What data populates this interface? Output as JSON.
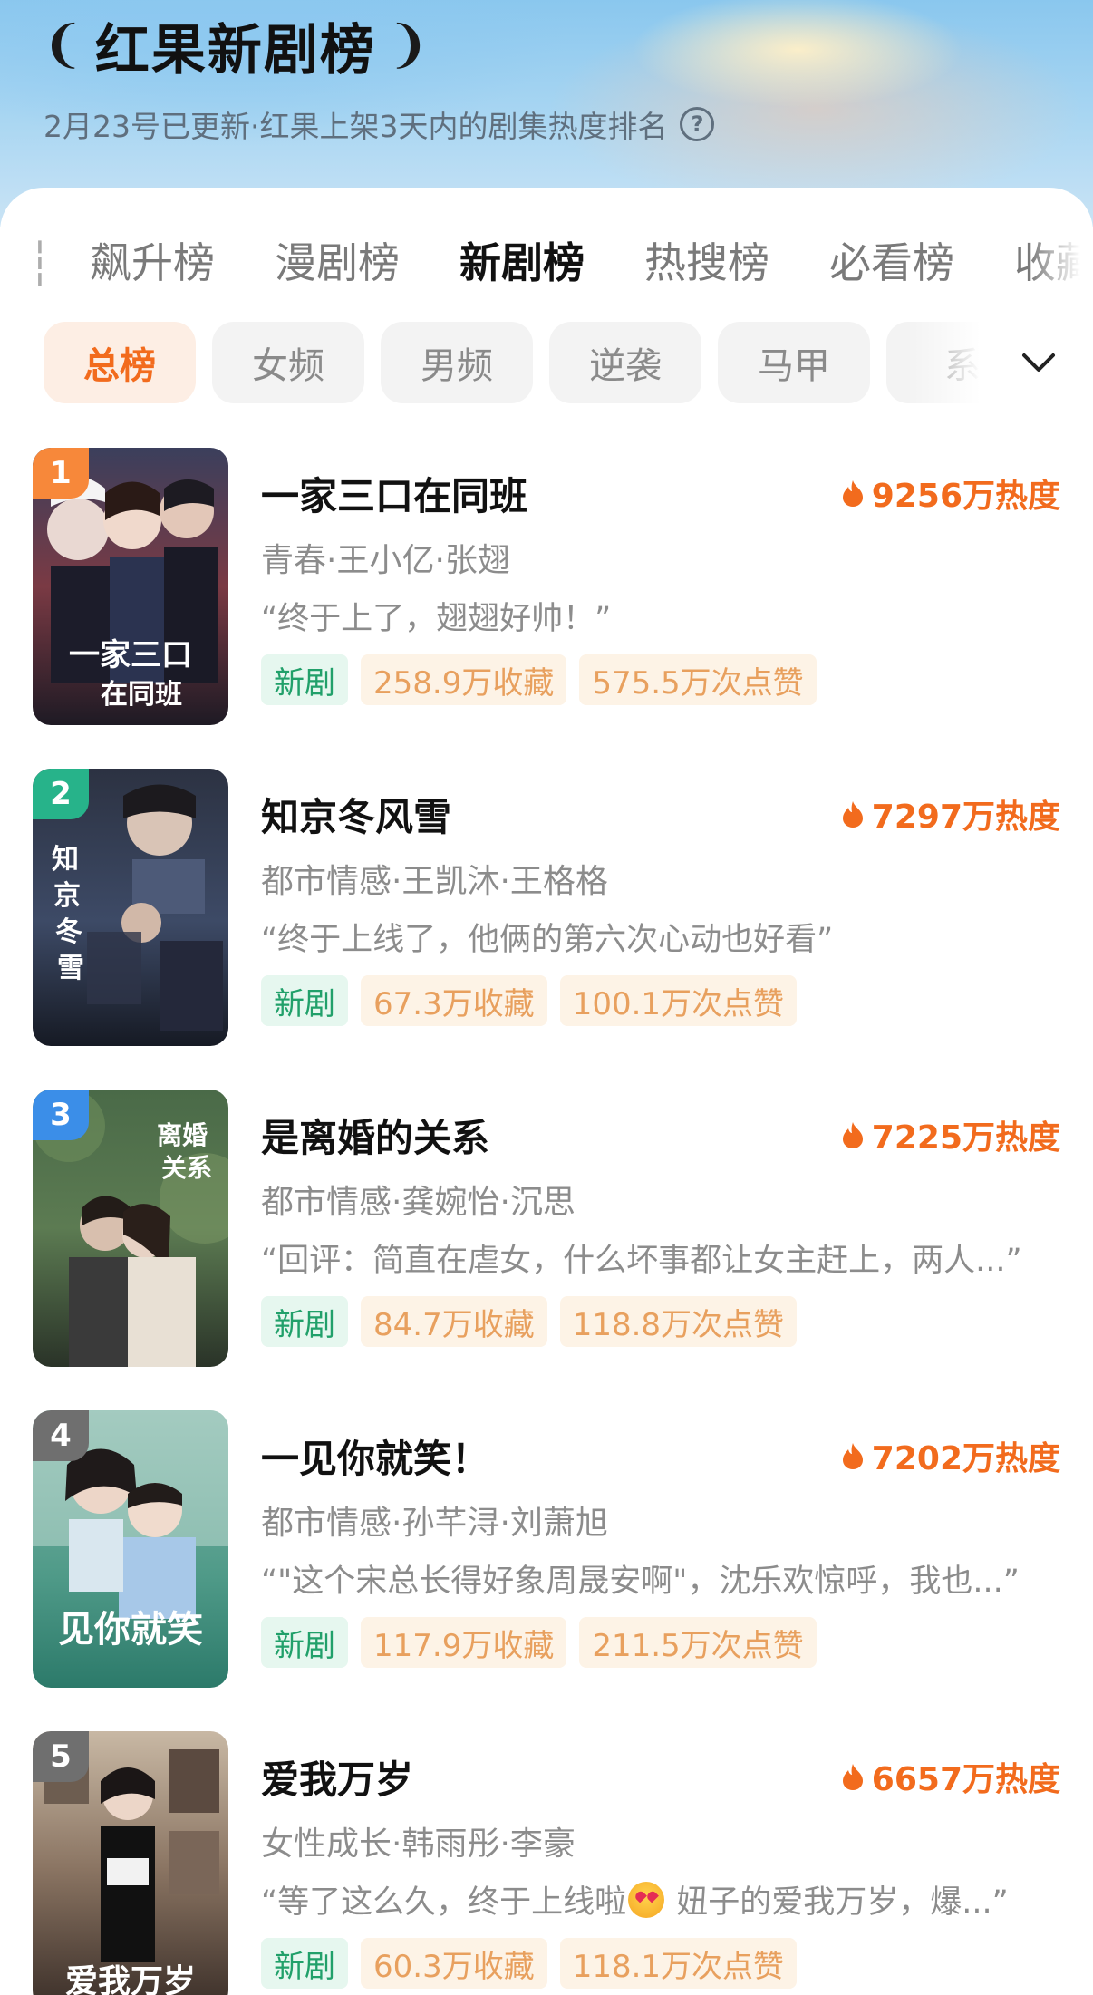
{
  "header": {
    "title": "红果新剧榜",
    "subtitle": "2月23号已更新·红果上架3天内的剧集热度排名"
  },
  "tabs": [
    {
      "label": "飙升榜"
    },
    {
      "label": "漫剧榜"
    },
    {
      "label": "新剧榜",
      "active": true
    },
    {
      "label": "热搜榜"
    },
    {
      "label": "必看榜"
    },
    {
      "label": "收藏"
    }
  ],
  "chips": [
    {
      "label": "总榜",
      "active": true
    },
    {
      "label": "女频"
    },
    {
      "label": "男频"
    },
    {
      "label": "逆袭"
    },
    {
      "label": "马甲"
    },
    {
      "label": "系"
    }
  ],
  "colors": {
    "accent": "#f26b1d",
    "new_tag_bg": "#e6f7ef",
    "new_tag_text": "#21a06a",
    "stat_tag_bg": "#fdf3e6",
    "stat_tag_text": "#e8a05e",
    "rank1": "#f7883a",
    "rank2": "#27b38a",
    "rank3": "#3b8ee8",
    "rank_other": "#6f6f6f"
  },
  "items": [
    {
      "rank": "1",
      "title": "一家三口在同班",
      "heat": "9256万热度",
      "meta": "青春·王小亿·张翅",
      "quote": "“终于上了，翅翅好帅！”",
      "tag_new": "新剧",
      "favorites": "258.9万收藏",
      "likes": "575.5万次点赞",
      "poster_text": "一家三口在同班"
    },
    {
      "rank": "2",
      "title": "知京冬风雪",
      "heat": "7297万热度",
      "meta": "都市情感·王凯沐·王格格",
      "quote": "“终于上线了，他俩的第六次心动也好看”",
      "tag_new": "新剧",
      "favorites": "67.3万收藏",
      "likes": "100.1万次点赞",
      "poster_text": "知京冬风雪"
    },
    {
      "rank": "3",
      "title": "是离婚的关系",
      "heat": "7225万热度",
      "meta": "都市情感·龚婉怡·沉思",
      "quote": "“回评：简直在虐女，什么坏事都让女主赶上，两人...”",
      "tag_new": "新剧",
      "favorites": "84.7万收藏",
      "likes": "118.8万次点赞",
      "poster_text": "是离婚的关系"
    },
    {
      "rank": "4",
      "title": "一见你就笑！",
      "heat": "7202万热度",
      "meta": "都市情感·孙芊浔·刘萧旭",
      "quote": "“\"这个宋总长得好象周晟安啊\"，沈乐欢惊呼，我也...”",
      "tag_new": "新剧",
      "favorites": "117.9万收藏",
      "likes": "211.5万次点赞",
      "poster_text": "一见你就笑！"
    },
    {
      "rank": "5",
      "title": "爱我万岁",
      "heat": "6657万热度",
      "meta": "女性成长·韩雨彤·李豪",
      "quote_before": "“等了这么久，终于上线啦",
      "quote_after": " 妞子的爱我万岁，爆...”",
      "quote_emoji": "heart-eyes-emoji",
      "tag_new": "新剧",
      "favorites": "60.3万收藏",
      "likes": "118.1万次点赞",
      "poster_text": "爱我万岁"
    }
  ]
}
